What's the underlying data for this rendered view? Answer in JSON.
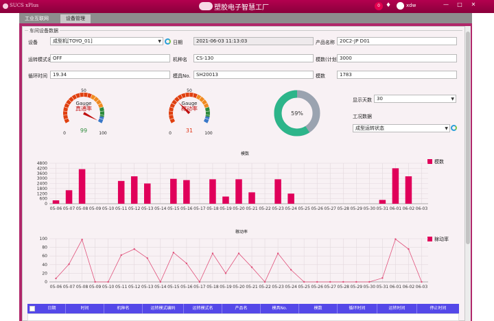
{
  "app": {
    "logo_text": "SUCS xPlus",
    "title": "塑胶电子智慧工厂",
    "notification_count": "0",
    "user": "xdw"
  },
  "tabs": [
    {
      "label": "工业互联网",
      "active": false
    },
    {
      "label": "设备管理",
      "active": true
    }
  ],
  "section": {
    "title": "车间设备数据"
  },
  "form": {
    "equipment_label": "设备",
    "equipment_value": "成型机[TOYO_01]",
    "date_label": "日期",
    "date_value": "2021-06-03 11:13:03",
    "product_label": "产品名称",
    "product_value": "20C2-JP D01",
    "mode_label": "运转模式名",
    "mode_value": "OFF",
    "model_label": "机种名",
    "model_value": "CS-130",
    "plan_label": "模数(计划",
    "plan_value": "3000",
    "cycle_label": "循环时间",
    "cycle_value": "19.34",
    "mold_label": "模具No.",
    "mold_value": "SH20013",
    "count_label": "模数",
    "count_value": "1783"
  },
  "gauges": [
    {
      "name": "Gauge",
      "subtitle": "真通率",
      "value": 99,
      "min": "0",
      "mid": "50",
      "max": "100",
      "value_label": "99",
      "value_color": "#2e8b3c"
    },
    {
      "name": "Gauge",
      "subtitle": "稼动率",
      "value": 31,
      "min": "0",
      "mid": "50",
      "max": "100",
      "value_label": "31",
      "value_color": "#e03010"
    }
  ],
  "donut": {
    "percent": 59,
    "label": "59%",
    "color_fill": "#2db58a",
    "color_rest": "#9aa3b0"
  },
  "controls": {
    "days_label": "显示天数",
    "days_value": "30",
    "process_label": "工况数据",
    "process_value": "成型运转状态"
  },
  "colors": {
    "accent": "#b0276a",
    "bar": "#e0005a",
    "line": "#e0507a",
    "table_header": "#5448e8"
  },
  "chart_data": [
    {
      "type": "bar",
      "title": "模数",
      "legend": "模数",
      "categories": [
        "05-06",
        "05-07",
        "05-08",
        "05-09",
        "05-10",
        "05-11",
        "05-12",
        "05-13",
        "05-14",
        "05-15",
        "05-16",
        "05-17",
        "05-18",
        "05-19",
        "05-20",
        "05-21",
        "05-22",
        "05-23",
        "05-24",
        "05-25",
        "05-26",
        "05-27",
        "05-28",
        "05-29",
        "05-30",
        "05-31",
        "06-01",
        "06-02",
        "06-03"
      ],
      "values": [
        400,
        1600,
        4100,
        0,
        0,
        2700,
        3250,
        2400,
        0,
        2950,
        2800,
        0,
        2900,
        850,
        2900,
        1350,
        0,
        2900,
        1200,
        0,
        0,
        0,
        0,
        0,
        0,
        450,
        4200,
        3250,
        0
      ],
      "yticks": [
        "0",
        "600",
        "1200",
        "1800",
        "2400",
        "3000",
        "3600",
        "4200",
        "4800"
      ],
      "ylim": [
        0,
        4800
      ]
    },
    {
      "type": "line",
      "title": "稼动率",
      "legend": "稼动率",
      "categories": [
        "05-06",
        "05-07",
        "05-08",
        "05-09",
        "05-10",
        "05-11",
        "05-12",
        "05-13",
        "05-14",
        "05-15",
        "05-16",
        "05-17",
        "05-18",
        "05-19",
        "05-20",
        "05-21",
        "05-22",
        "05-23",
        "05-24",
        "05-25",
        "05-26",
        "05-27",
        "05-28",
        "05-29",
        "05-30",
        "05-31",
        "06-01",
        "06-02",
        "06-03"
      ],
      "values": [
        8,
        41,
        98,
        0,
        0,
        62,
        76,
        55,
        0,
        68,
        43,
        0,
        66,
        20,
        66,
        34,
        0,
        66,
        28,
        0,
        0,
        0,
        0,
        0,
        0,
        9,
        99,
        76,
        0
      ],
      "yticks": [
        "0",
        "20",
        "40",
        "60",
        "80",
        "100"
      ],
      "ylim": [
        0,
        100
      ]
    }
  ],
  "table": {
    "columns": [
      "日期",
      "时间",
      "机种名",
      "运转模式编码",
      "运转模式名",
      "产品名",
      "模具No.",
      "模数",
      "循环时间",
      "运转时间",
      "停止时间"
    ]
  }
}
